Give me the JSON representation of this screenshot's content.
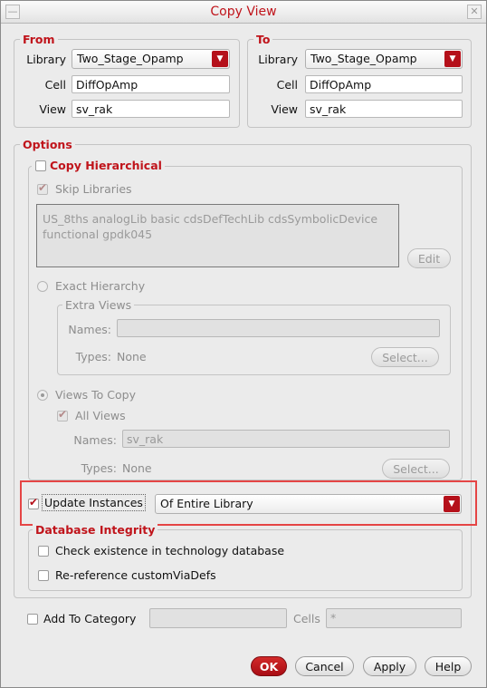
{
  "window": {
    "title": "Copy View"
  },
  "from": {
    "legend": "From",
    "library_label": "Library",
    "library_value": "Two_Stage_Opamp",
    "cell_label": "Cell",
    "cell_value": "DiffOpAmp",
    "view_label": "View",
    "view_value": "sv_rak"
  },
  "to": {
    "legend": "To",
    "library_label": "Library",
    "library_value": "Two_Stage_Opamp",
    "cell_label": "Cell",
    "cell_value": "DiffOpAmp",
    "view_label": "View",
    "view_value": "sv_rak"
  },
  "options": {
    "legend": "Options",
    "copy_hierarchical": {
      "label": "Copy Hierarchical",
      "checked": false
    },
    "skip_libraries": {
      "label": "Skip Libraries",
      "checked": true
    },
    "libraries_list": "US_8ths analogLib basic cdsDefTechLib cdsSymbolicDevice functional gpdk045",
    "edit_button": "Edit",
    "exact_hierarchy": {
      "label": "Exact Hierarchy",
      "selected": false
    },
    "extra_views": {
      "legend": "Extra Views",
      "names_label": "Names:",
      "names_value": "",
      "types_label": "Types:",
      "types_value": "None",
      "select_button": "Select..."
    },
    "views_to_copy": {
      "label": "Views To Copy",
      "selected": true
    },
    "all_views": {
      "label": "All Views",
      "checked": true
    },
    "names_label": "Names:",
    "names_value": "sv_rak",
    "types_label": "Types:",
    "types_value": "None",
    "select_button": "Select...",
    "update_instances": {
      "label": "Update Instances",
      "checked": true
    },
    "update_scope": "Of Entire Library",
    "database_integrity": {
      "legend": "Database Integrity",
      "check_existence": {
        "label": "Check existence in technology database",
        "checked": false
      },
      "re_reference": {
        "label": "Re-reference customViaDefs",
        "checked": false
      }
    }
  },
  "category": {
    "add_label": "Add To Category",
    "checked": false,
    "category_value": "",
    "cells_label": "Cells",
    "cells_value": "*"
  },
  "buttons": {
    "ok": "OK",
    "cancel": "Cancel",
    "apply": "Apply",
    "help": "Help"
  },
  "colors": {
    "accent": "#c0141b",
    "highlight": "#e54545"
  }
}
